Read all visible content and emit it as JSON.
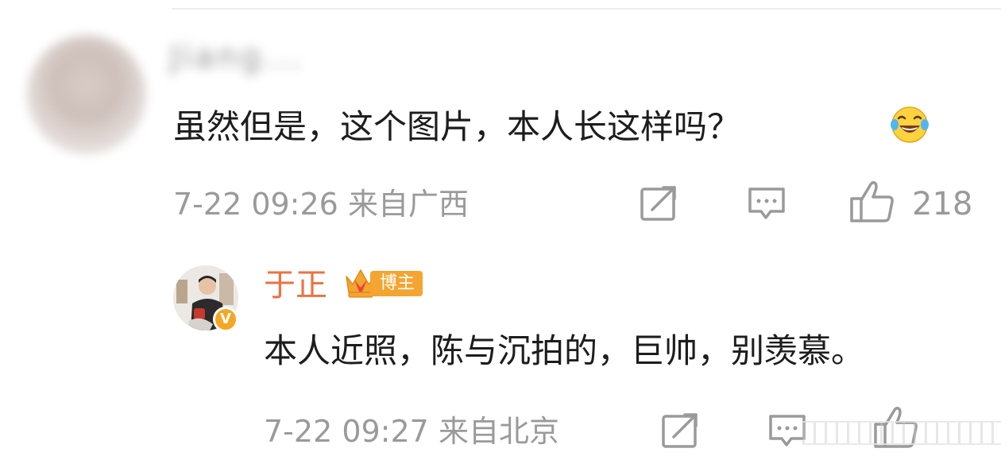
{
  "main_comment": {
    "username": "Jiang...",
    "text": "虽然但是，这个图片，本人长这样吗？",
    "emoji": "laughing-tears-icon",
    "time": "7-22 09:26",
    "location": "来自广西",
    "likes": "218"
  },
  "reply": {
    "username": "于正",
    "badge": "博主",
    "verified": "V",
    "text": "本人近照，陈与沉拍的，巨帅，别羡慕。",
    "time": "7-22 09:27",
    "location": "来自北京"
  },
  "colors": {
    "name_accent": "#eb7340",
    "badge_bg": "#f4a531",
    "meta_gray": "#9a9a9a",
    "text": "#1d1d1d"
  }
}
